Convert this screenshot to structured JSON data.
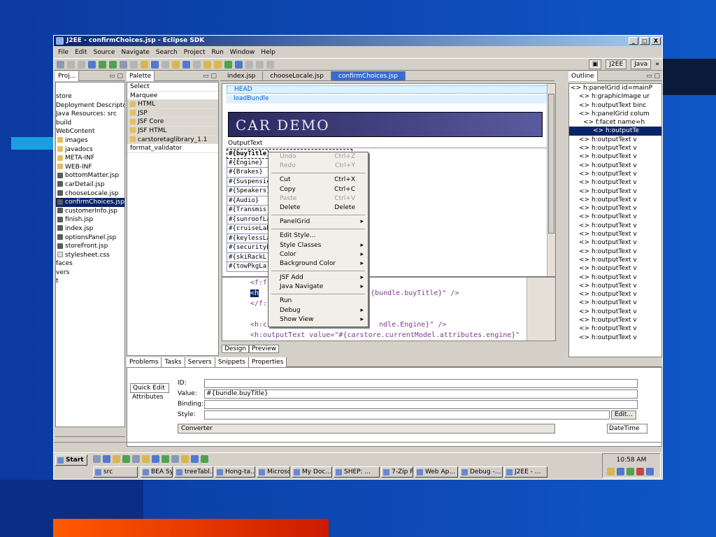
{
  "window": {
    "title": "J2EE - confirmChoices.jsp - Eclipse SDK",
    "min": "_",
    "max": "□",
    "close": "X"
  },
  "menu": [
    "File",
    "Edit",
    "Source",
    "Navigate",
    "Search",
    "Project",
    "Run",
    "Window",
    "Help"
  ],
  "perspectives": {
    "j2ee": "J2EE",
    "java": "Java",
    "more": "»"
  },
  "project_panel": {
    "tab": "Proj...",
    "items": [
      {
        "label": "store",
        "type": "none"
      },
      {
        "label": "Deployment Descriptor",
        "type": "none"
      },
      {
        "label": "Java Resources: src",
        "type": "none"
      },
      {
        "label": "build",
        "type": "none"
      },
      {
        "label": "WebContent",
        "type": "none"
      },
      {
        "label": "images",
        "type": "fold"
      },
      {
        "label": "javadocs",
        "type": "fold"
      },
      {
        "label": "META-INF",
        "type": "fold"
      },
      {
        "label": "WEB-INF",
        "type": "fold"
      },
      {
        "label": "bottomMatter.jsp",
        "type": "jsp"
      },
      {
        "label": "carDetail.jsp",
        "type": "jsp"
      },
      {
        "label": "chooseLocale.jsp",
        "type": "jsp"
      },
      {
        "label": "confirmChoices.jsp",
        "type": "jsp",
        "selected": true
      },
      {
        "label": "customerInfo.jsp",
        "type": "jsp"
      },
      {
        "label": "finish.jsp",
        "type": "jsp"
      },
      {
        "label": "index.jsp",
        "type": "jsp"
      },
      {
        "label": "optionsPanel.jsp",
        "type": "jsp"
      },
      {
        "label": "storeFront.jsp",
        "type": "jsp"
      },
      {
        "label": "stylesheet.css",
        "type": "css"
      },
      {
        "label": "faces",
        "type": "none"
      },
      {
        "label": "vers",
        "type": "none"
      },
      {
        "label": "t",
        "type": "none"
      }
    ]
  },
  "palette_panel": {
    "tab": "Palette",
    "items": [
      "Select",
      "Marquee",
      "HTML",
      "JSP",
      "JSF Core",
      "JSF HTML",
      "carstoretaglibrary_1.1",
      "format_validator"
    ]
  },
  "editor": {
    "tabs": [
      "index.jsp",
      "chooseLocale.jsp",
      "confirmChoices.jsp"
    ],
    "active_tab": "confirmChoices.jsp",
    "head_label": "HEAD",
    "loadbundle_label": "loadBundle",
    "banner": "CAR DEMO",
    "output_text": "OutputText",
    "values": [
      "#{buyTitle}",
      "#{Engine}",
      "#{Brakes}",
      "#{Suspensic",
      "#{Speakers}",
      "#{Audio}",
      "#{Transmis:",
      "#{sunroofLa",
      "#{cruiseLab",
      "#{keylessLa",
      "#{securityL",
      "#{skiRackL",
      "#{towPkgLa"
    ],
    "source_lines": [
      "<f:f",
      "<h",
      "</f:",
      "",
      "<h:c",
      "<h:outputText value=\"#{carstore.currentModel.attributes.engine}\""
    ],
    "source_sel_frag1": "{bundle.buyTitle}\" />",
    "source_frag2": "ndle.Engine}\" />",
    "design_tab": "Design",
    "preview_tab": "Preview"
  },
  "context_menu": {
    "items": [
      {
        "label": "Undo",
        "shortcut": "Ctrl+Z",
        "disabled": true
      },
      {
        "label": "Redo",
        "shortcut": "Ctrl+Y",
        "disabled": true
      },
      {
        "sep": true
      },
      {
        "label": "Cut",
        "shortcut": "Ctrl+X"
      },
      {
        "label": "Copy",
        "shortcut": "Ctrl+C"
      },
      {
        "label": "Paste",
        "shortcut": "Ctrl+V",
        "disabled": true
      },
      {
        "label": "Delete",
        "shortcut": "Delete"
      },
      {
        "sep": true
      },
      {
        "label": "PanelGrid",
        "submenu": true
      },
      {
        "sep": true
      },
      {
        "label": "Edit Style..."
      },
      {
        "label": "Style Classes",
        "submenu": true
      },
      {
        "label": "Color",
        "submenu": true
      },
      {
        "label": "Background Color",
        "submenu": true
      },
      {
        "sep": true
      },
      {
        "label": "JSF Add",
        "submenu": true
      },
      {
        "label": "Java Navigate",
        "submenu": true
      },
      {
        "sep": true
      },
      {
        "label": "Run"
      },
      {
        "label": "Debug",
        "submenu": true
      },
      {
        "label": "Show View",
        "submenu": true
      }
    ]
  },
  "outline_panel": {
    "tab": "Outline",
    "items": [
      "h:panelGrid id=mainP",
      "h:graphicImage ur",
      "h:outputText binc",
      "h:panelGrid colum",
      "f:facet name=h",
      "h:outputTe",
      "h:outputText v",
      "h:outputText v",
      "h:outputText v",
      "h:outputText v",
      "h:outputText v",
      "h:outputText v",
      "h:outputText v",
      "h:outputText v",
      "h:outputText v",
      "h:outputText v",
      "h:outputText v",
      "h:outputText v",
      "h:outputText v",
      "h:outputText v",
      "h:outputText v",
      "h:outputText v",
      "h:outputText v",
      "h:outputText v",
      "h:outputText v",
      "h:outputText v",
      "h:outputText v",
      "h:outputText v",
      "h:outputText v",
      "h:outputText v"
    ],
    "selected_index": 5
  },
  "bottom": {
    "tabs": [
      "Problems",
      "Tasks",
      "Servers",
      "Snippets",
      "Properties"
    ],
    "side_tabs": [
      "Quick Edit",
      "Attributes"
    ],
    "fields": {
      "id_label": "ID:",
      "value_label": "Value:",
      "value": "#{bundle.buyTitle}",
      "binding_label": "Binding:",
      "style_label": "Style:",
      "converter_label": "Converter",
      "edit_btn": "Edit...",
      "datetime": "DateTime"
    }
  },
  "taskbar": {
    "start": "Start",
    "buttons": [
      "src",
      "BEA Sys...",
      "treeTabl...",
      "Hong-ta...",
      "Microsof...",
      "My Doc...",
      "SHEP: ...",
      "7-Zip Fil...",
      "Web Ap...",
      "Debug -...",
      "J2EE - ..."
    ],
    "clock": "10:58 AM"
  }
}
